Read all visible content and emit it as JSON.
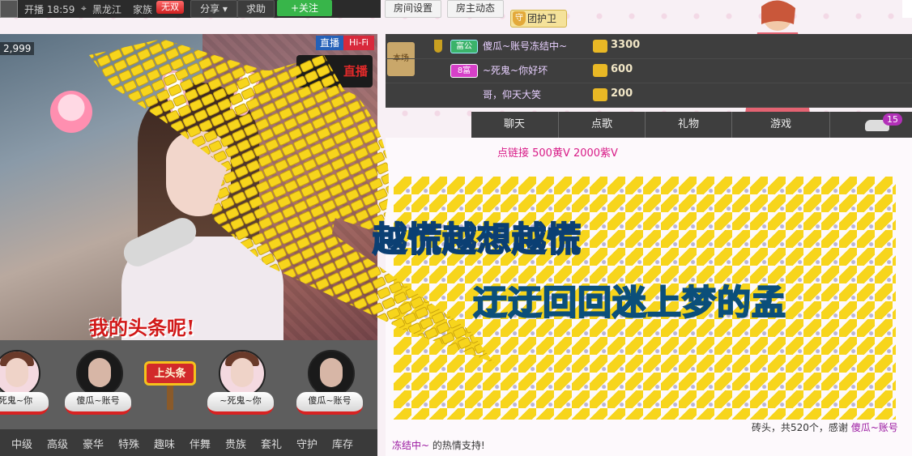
{
  "topbar": {
    "status": "开播 18:59",
    "location": "黑龙江",
    "family_label": "家族",
    "family_badge": "无双",
    "share_label": "分享",
    "help_label": "求助",
    "follow_label": "关注",
    "room_settings_label": "房间设置",
    "host_news_label": "房主动态",
    "guard_label": "团护卫"
  },
  "video": {
    "viewer_count": "2,999",
    "live_tag": "直播",
    "hifi_tag": "Hi-Fi",
    "live_sign": "直播",
    "overlay_text": "我的头条呢!"
  },
  "headline": {
    "button_label": "上头条",
    "slots": [
      {
        "name": "死鬼~你"
      },
      {
        "name": "傻瓜~账号"
      },
      {
        "name": "~死鬼~你"
      },
      {
        "name": "傻瓜~账号"
      }
    ]
  },
  "gift_categories": [
    "中级",
    "高级",
    "豪华",
    "特殊",
    "趣味",
    "伴舞",
    "贵族",
    "套礼",
    "守护",
    "库存"
  ],
  "rank": {
    "scene_label": "本场",
    "rows": [
      {
        "level": "富公",
        "name": "傻瓜~账号冻结中~",
        "value": "3300"
      },
      {
        "level": "8富",
        "name": "~死鬼~你好坏",
        "value": "600"
      },
      {
        "level": "",
        "name": "哥，仰天大笑",
        "value": "200"
      }
    ]
  },
  "tabs": [
    "聊天",
    "点歌",
    "礼物",
    "游戏"
  ],
  "tab_badge": "15",
  "chat": {
    "top_line": "点链接 500黄V 2000紫V",
    "foot_prefix": "砖头，共520个，感谢",
    "foot_user": "傻瓜~账号",
    "foot_user_cont": "冻结中~",
    "foot_suffix": "的热情支持!"
  },
  "lyrics": {
    "line1": "越慌越想越慌",
    "line2": "迂迂回回迷上梦的孟"
  },
  "colors": {
    "follow_green": "#38b54a",
    "live_blue": "#2561b8",
    "hifi_red": "#d8293c",
    "brick_yellow": "#f7d51c",
    "chat_pink": "#d81b87",
    "user_purple": "#9a18a0"
  }
}
